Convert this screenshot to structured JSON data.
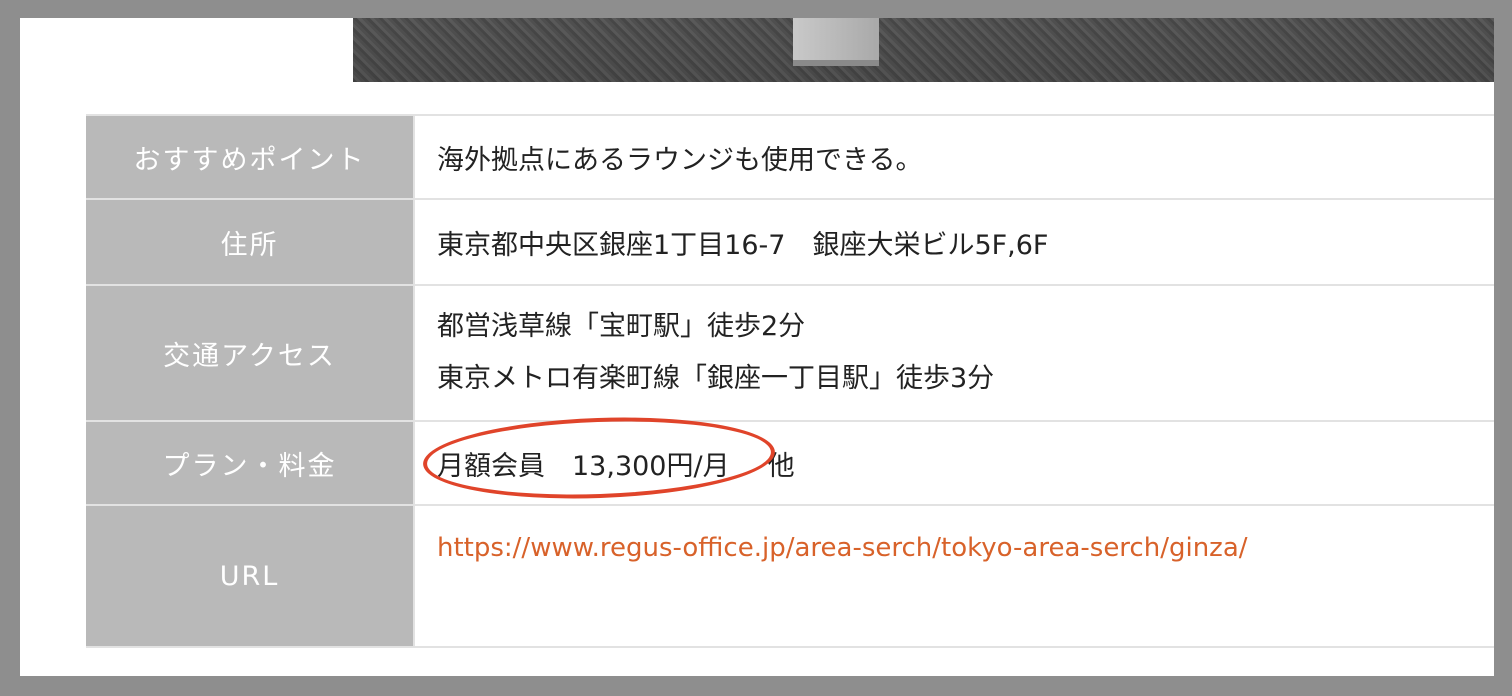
{
  "colors": {
    "header_bg": "#b9b9b9",
    "header_text": "#ffffff",
    "link": "#d8622a",
    "highlight_circle": "#e0442a",
    "frame": "#8e8e8e"
  },
  "table": {
    "rows": [
      {
        "label": "おすすめポイント",
        "value": "海外拠点にあるラウンジも使用できる。"
      },
      {
        "label": "住所",
        "value": "東京都中央区銀座1丁目16-7　銀座大栄ビル5F,6F"
      },
      {
        "label": "交通アクセス",
        "lines": [
          "都営浅草線「宝町駅」徒歩2分",
          "東京メトロ有楽町線「銀座一丁目駅」徒歩3分"
        ]
      },
      {
        "label": "プラン・料金",
        "price": "月額会員　13,300円/月",
        "other": "他"
      },
      {
        "label": "URL",
        "url": "https://www.regus-office.jp/area-serch/tokyo-area-serch/ginza/"
      }
    ]
  }
}
